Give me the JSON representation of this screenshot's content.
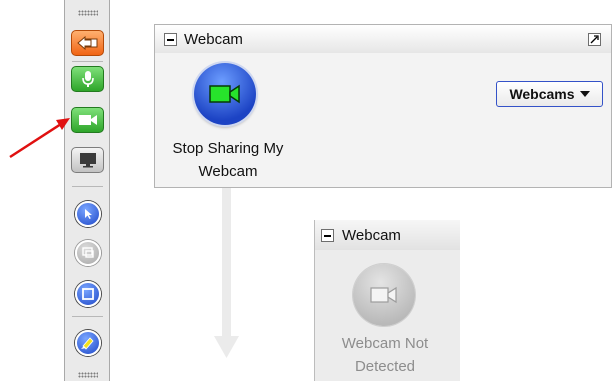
{
  "toolbar": {
    "buttons": [
      {
        "name": "exit-button",
        "icon": "exit-arrow-icon"
      },
      {
        "name": "microphone-button",
        "icon": "microphone-icon"
      },
      {
        "name": "webcam-button",
        "icon": "camera-icon"
      },
      {
        "name": "screen-share-button",
        "icon": "monitor-icon"
      },
      {
        "name": "pointer-tool-button",
        "icon": "pointer-icon"
      },
      {
        "name": "annotate-tool-button",
        "icon": "screen-annotate-icon",
        "disabled": true
      },
      {
        "name": "whiteboard-button",
        "icon": "whiteboard-icon"
      },
      {
        "name": "highlighter-button",
        "icon": "highlighter-icon"
      }
    ]
  },
  "webcam_pod": {
    "title": "Webcam",
    "action_label_line1": "Stop Sharing My",
    "action_label_line2": "Webcam",
    "dropdown_label": "Webcams"
  },
  "disabled_pod": {
    "title": "Webcam",
    "status_line1": "Webcam Not",
    "status_line2": "Detected"
  },
  "colors": {
    "active_green": "#2ea52a",
    "primary_blue": "#1f48c8",
    "exit_orange": "#f06414",
    "callout_red": "#e01010",
    "disabled_text": "#8d8d8d"
  }
}
